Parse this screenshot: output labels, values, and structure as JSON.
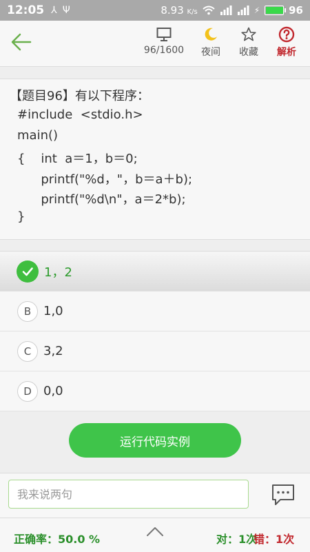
{
  "status_bar": {
    "time": "12:05",
    "speed": "8.93",
    "speed_unit": "K/s",
    "battery": "96",
    "battery_level": 0.96
  },
  "toolbar": {
    "progress": "96/1600",
    "night": "夜间",
    "favorite": "收藏",
    "analysis": "解析"
  },
  "question": {
    "lines": [
      "【题目96】有以下程序：",
      "#include  <stdio.h>",
      "main()",
      "{    int  a＝1，b＝0;",
      "      printf(\"%d，\"，b＝a＋b);",
      "      printf(\"%d\\n\"，a＝2*b);",
      "}"
    ]
  },
  "options": [
    {
      "letter": "A",
      "text": "1，2",
      "correct": true
    },
    {
      "letter": "B",
      "text": "1,0"
    },
    {
      "letter": "C",
      "text": "3,2"
    },
    {
      "letter": "D",
      "text": "0,0"
    }
  ],
  "run_button": "运行代码实例",
  "comment": {
    "placeholder": "我来说两句"
  },
  "stats": {
    "accuracy": "正确率：50.0 %",
    "right": "对：1次",
    "wrong": "错：1次"
  },
  "colors": {
    "accent_green": "#3fc44a",
    "analysis_red": "#c1272d"
  }
}
